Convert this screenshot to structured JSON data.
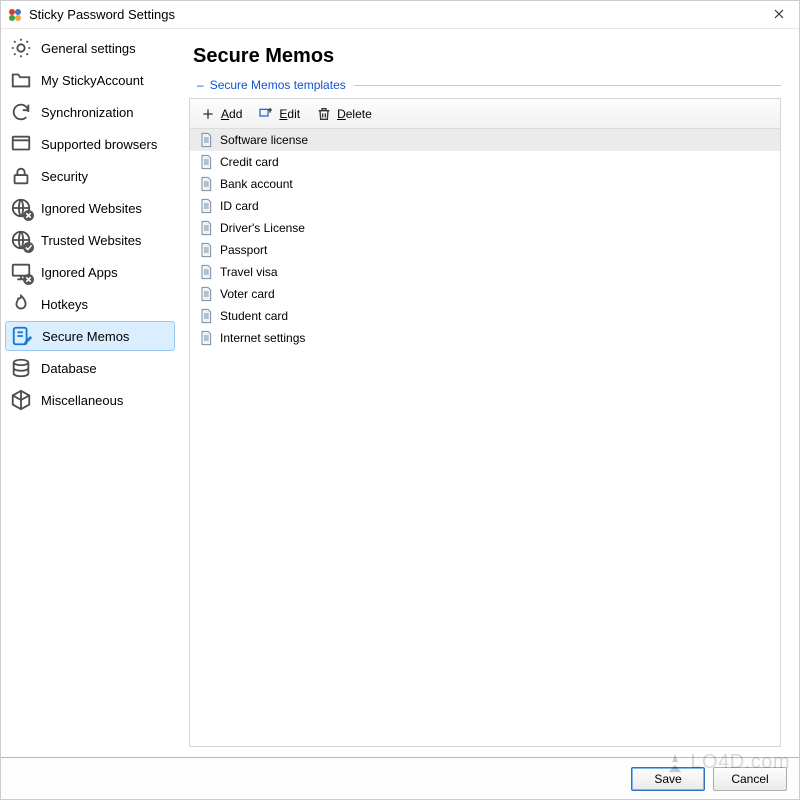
{
  "window": {
    "title": "Sticky Password Settings"
  },
  "sidebar": {
    "items": [
      {
        "id": "general",
        "label": "General settings",
        "icon": "gear-icon"
      },
      {
        "id": "account",
        "label": "My StickyAccount",
        "icon": "folder-icon"
      },
      {
        "id": "sync",
        "label": "Synchronization",
        "icon": "sync-icon"
      },
      {
        "id": "browsers",
        "label": "Supported browsers",
        "icon": "browser-icon"
      },
      {
        "id": "security",
        "label": "Security",
        "icon": "lock-icon"
      },
      {
        "id": "ignored-w",
        "label": "Ignored Websites",
        "icon": "globe-blocked-icon"
      },
      {
        "id": "trusted-w",
        "label": "Trusted Websites",
        "icon": "globe-check-icon"
      },
      {
        "id": "ignored-a",
        "label": "Ignored Apps",
        "icon": "monitor-blocked-icon"
      },
      {
        "id": "hotkeys",
        "label": "Hotkeys",
        "icon": "flame-icon"
      },
      {
        "id": "memos",
        "label": "Secure Memos",
        "icon": "note-edit-icon",
        "selected": true
      },
      {
        "id": "database",
        "label": "Database",
        "icon": "database-icon"
      },
      {
        "id": "misc",
        "label": "Miscellaneous",
        "icon": "cube-icon"
      }
    ]
  },
  "main": {
    "title": "Secure Memos",
    "section_label": "Secure Memos templates",
    "toolbar": {
      "add_label": "Add",
      "edit_label": "Edit",
      "delete_label": "Delete"
    },
    "rows": [
      {
        "label": "Software license",
        "selected": true
      },
      {
        "label": "Credit card"
      },
      {
        "label": "Bank account"
      },
      {
        "label": "ID card"
      },
      {
        "label": "Driver's License"
      },
      {
        "label": "Passport"
      },
      {
        "label": "Travel visa"
      },
      {
        "label": "Voter card"
      },
      {
        "label": "Student card"
      },
      {
        "label": "Internet settings"
      }
    ]
  },
  "footer": {
    "save_label": "Save",
    "cancel_label": "Cancel"
  },
  "watermark": {
    "text": "LO4D.com"
  }
}
